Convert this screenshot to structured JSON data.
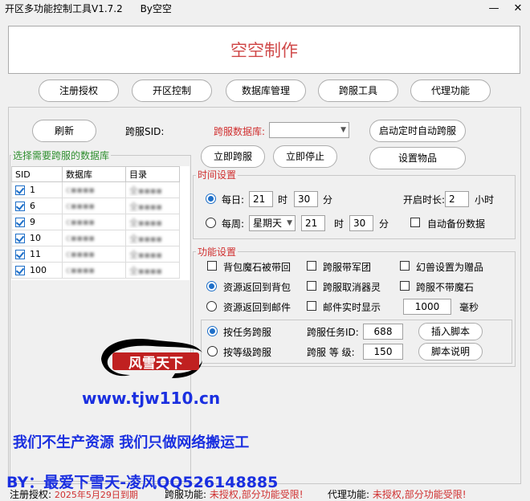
{
  "window": {
    "title": "开区多功能控制工具V1.7.2",
    "author": "By空空",
    "min_icon": "minimize-icon",
    "close_icon": "close-icon"
  },
  "banner": {
    "text": "空空制作"
  },
  "nav": [
    {
      "label": "注册授权"
    },
    {
      "label": "开区控制"
    },
    {
      "label": "数据库管理"
    },
    {
      "label": "跨服工具"
    },
    {
      "label": "代理功能"
    }
  ],
  "top": {
    "refresh": "刷新",
    "cross_sid_label": "跨服SID:",
    "cross_db_label": "跨服数据库:",
    "cross_db_value": "",
    "auto_timer_btn": "启动定时自动跨服",
    "cross_now_btn": "立即跨服",
    "stop_now_btn": "立即停止",
    "set_items_btn": "设置物品"
  },
  "db_group": {
    "title": "选择需要跨服的数据库",
    "columns": [
      "SID",
      "数据库",
      "目录"
    ],
    "rows": [
      {
        "sid": "1",
        "checked": true
      },
      {
        "sid": "6",
        "checked": true
      },
      {
        "sid": "9",
        "checked": true
      },
      {
        "sid": "10",
        "checked": true
      },
      {
        "sid": "11",
        "checked": true
      },
      {
        "sid": "100",
        "checked": true
      }
    ]
  },
  "time": {
    "title": "时间设置",
    "daily_label": "每日:",
    "daily_selected": true,
    "daily_hour": "21",
    "daily_min": "30",
    "hour_unit": "时",
    "min_unit": "分",
    "open_len_label": "开启时长:",
    "open_len_value": "2",
    "open_len_unit": "小时",
    "weekly_label": "每周:",
    "weekly_day": "星期天",
    "weekly_hour": "21",
    "weekly_min": "30",
    "auto_backup_label": "自动备份数据"
  },
  "func": {
    "title": "功能设置",
    "opt1": "背包魔石被带回",
    "opt2": "跨服带军团",
    "opt3": "幻兽设置为赠品",
    "res_back_bag": "资源返回到背包",
    "opt4": "跨服取消器灵",
    "opt5": "跨服不带魔石",
    "res_back_mail": "资源返回到邮件",
    "opt6": "邮件实时显示",
    "mail_ms_value": "1000",
    "mail_ms_unit": "毫秒",
    "by_task": "按任务跨服",
    "task_id_label": "跨服任务ID:",
    "task_id_value": "688",
    "insert_script": "插入脚本",
    "by_level": "按等级跨服",
    "level_label": "跨服 等 级:",
    "level_value": "150",
    "script_help": "脚本说明"
  },
  "watermark": {
    "logo_text": "风雪天下",
    "url": "www.tjw110.cn",
    "slogan": "我们不生产资源 我们只做网络搬运工",
    "by_line": "BY：最爱下雪天-凌风QQ526148885"
  },
  "status": {
    "reg_label": "注册授权:",
    "reg_value": "2025年5月29日到期",
    "cross_label": "跨服功能:",
    "cross_value": "未授权,部分功能受限!",
    "agent_label": "代理功能:",
    "agent_value": "未授权,部分功能受限!"
  },
  "colors": {
    "accent_red": "#d03030",
    "accent_green": "#2f8f2f",
    "check_blue": "#1e6fc8",
    "watermark_blue": "#1a2fe0"
  }
}
